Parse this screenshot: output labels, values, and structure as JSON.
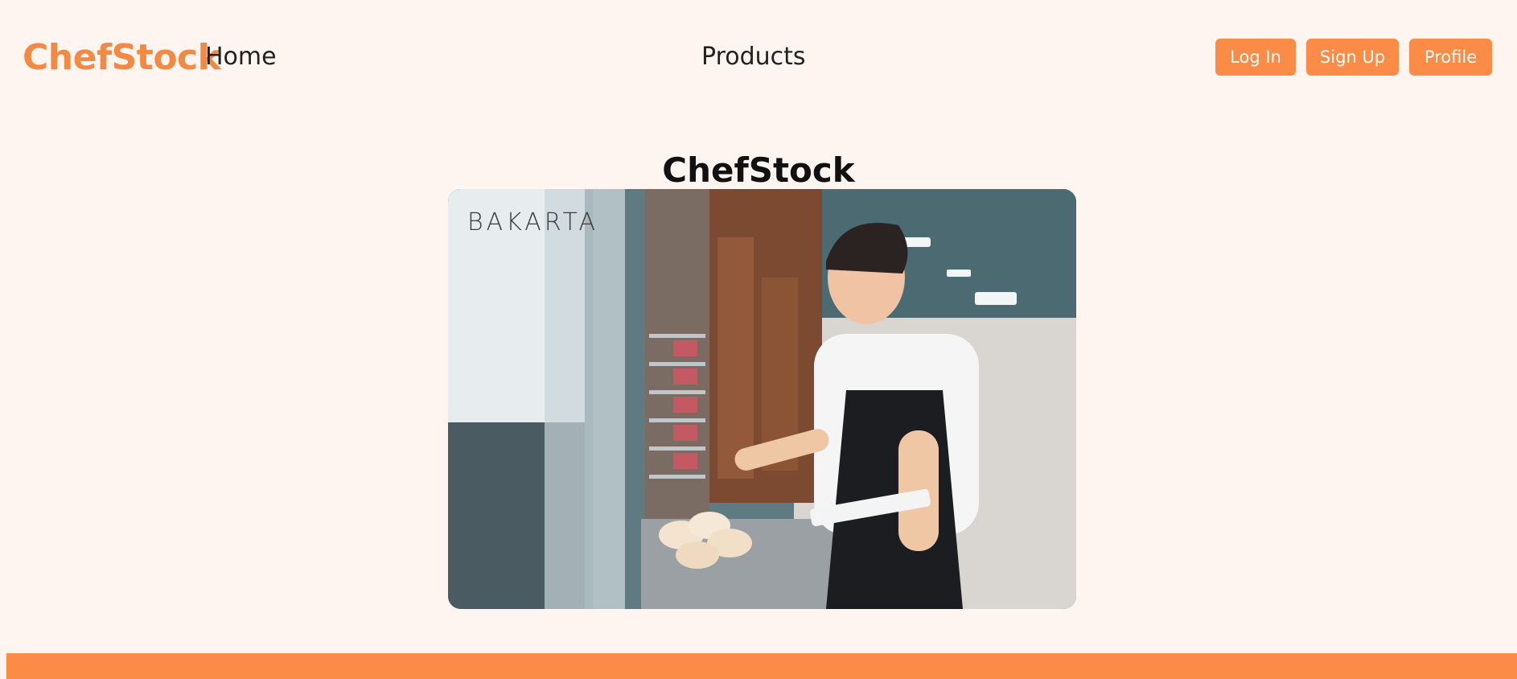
{
  "header": {
    "brand": "ChefStock",
    "nav": {
      "home": "Home",
      "products": "Products"
    },
    "buttons": {
      "login": "Log In",
      "signup": "Sign Up",
      "profile": "Profile"
    }
  },
  "main": {
    "title": "ChefStock",
    "hero": {
      "logo_text": "BAKARTA"
    }
  },
  "colors": {
    "accent": "#fb8c47",
    "brand_text": "#f28a46",
    "background": "#fff5f0"
  }
}
